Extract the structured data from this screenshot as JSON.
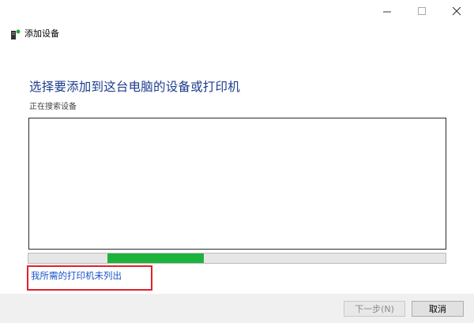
{
  "window": {
    "minimize_icon": "minimize-icon",
    "maximize_icon": "maximize-icon",
    "close_icon": "close-icon"
  },
  "wizard": {
    "title": "添加设备",
    "icon": "printer-device-icon"
  },
  "main": {
    "heading": "选择要添加到这台电脑的设备或打印机",
    "status": "正在搜索设备"
  },
  "progress": {
    "value_start": 0.19,
    "value_end": 0.42,
    "color": "#1cb33a"
  },
  "link": {
    "text": "我所需的打印机未列出",
    "highlight_color": "#e0202a"
  },
  "footer": {
    "next_label": "下一步(N)",
    "cancel_label": "取消"
  }
}
